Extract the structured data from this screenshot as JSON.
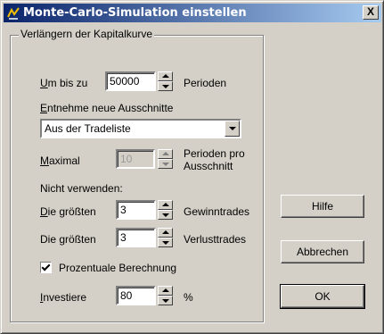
{
  "window": {
    "title": "Monte-Carlo-Simulation einstellen",
    "close_label": "X"
  },
  "group": {
    "legend": "Verlängern der Kapitalkurve",
    "um_bis_zu": {
      "mnemonic": "U",
      "rest": "m bis zu",
      "value": "50000",
      "unit": "Perioden"
    },
    "entnehme": {
      "mnemonic": "E",
      "rest": "ntnehme neue Ausschnitte",
      "selected": "Aus der Tradeliste"
    },
    "maximal": {
      "mnemonic": "M",
      "rest": "aximal",
      "value": "10",
      "unit_line1": "Perioden pro",
      "unit_line2": "Ausschnitt"
    },
    "nicht_verwenden": "Nicht verwenden:",
    "groesste_gewinn": {
      "mnemonic": "D",
      "rest": "ie größten",
      "value": "3",
      "unit": "Gewinntrades"
    },
    "groesste_verlust": {
      "pre": "Die ",
      "mnemonic": "g",
      "rest": "rößten",
      "value": "3",
      "unit": "Verlusttrades"
    },
    "prozentuale": {
      "label": "Prozentuale Berechnung",
      "checked": true
    },
    "investiere": {
      "mnemonic": "I",
      "rest": "nvestiere",
      "value": "80",
      "unit": "%"
    }
  },
  "buttons": {
    "help": "Hilfe",
    "cancel": "Abbrechen",
    "ok": "OK"
  }
}
